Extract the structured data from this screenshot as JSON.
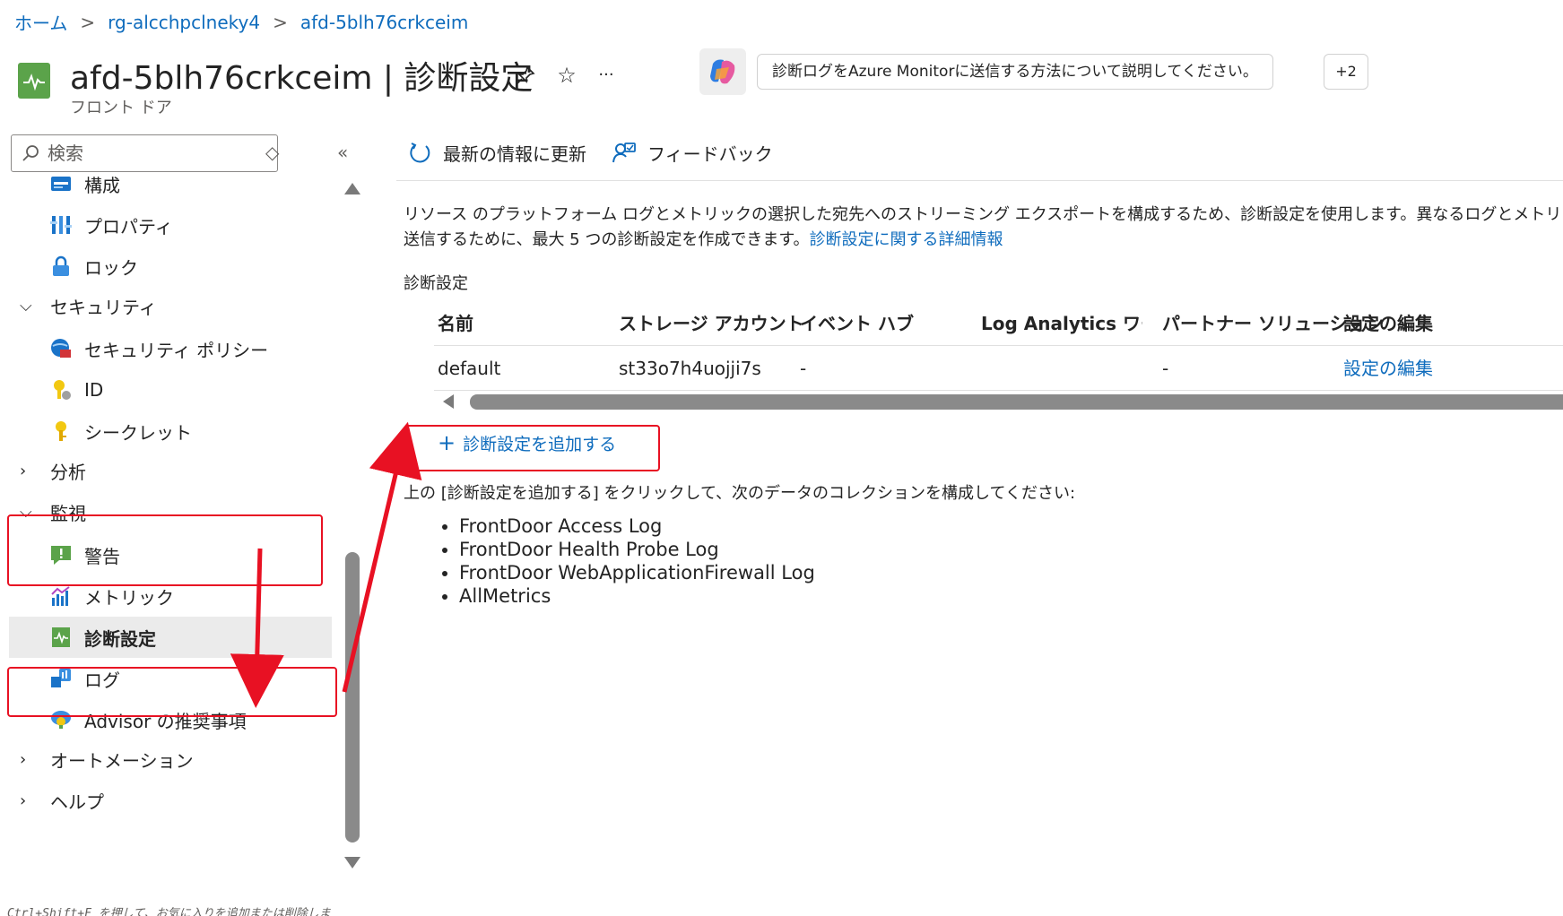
{
  "breadcrumb": {
    "items": [
      "ホーム",
      "rg-alcchpclneky4",
      "afd-5blh76crkceim"
    ],
    "separator": ">"
  },
  "header": {
    "title": "afd-5blh76crkceim | 診断設定",
    "subtitle": "フロント ドア",
    "pin_icon": "pin-icon",
    "star_icon": "star-icon",
    "more_label": "···",
    "copilot_prompt": "診断ログをAzure Monitorに送信する方法について説明してください。",
    "more_prompts": "+2"
  },
  "sidebar": {
    "search_placeholder": "検索",
    "updown_label": "◇",
    "collapse_label": "«",
    "items": [
      {
        "label": "構成",
        "type": "item",
        "icon": "config-icon"
      },
      {
        "label": "プロパティ",
        "type": "item",
        "icon": "properties-icon"
      },
      {
        "label": "ロック",
        "type": "item",
        "icon": "lock-icon"
      },
      {
        "label": "セキュリティ",
        "type": "group",
        "expanded": true
      },
      {
        "label": "セキュリティ ポリシー",
        "type": "item",
        "icon": "security-policy-icon"
      },
      {
        "label": "ID",
        "type": "item",
        "icon": "identity-icon"
      },
      {
        "label": "シークレット",
        "type": "item",
        "icon": "key-icon"
      },
      {
        "label": "分析",
        "type": "group",
        "expanded": false
      },
      {
        "label": "監視",
        "type": "group",
        "expanded": true
      },
      {
        "label": "警告",
        "type": "item",
        "icon": "alert-icon"
      },
      {
        "label": "メトリック",
        "type": "item",
        "icon": "metrics-icon"
      },
      {
        "label": "診断設定",
        "type": "item",
        "icon": "diagnostic-icon",
        "active": true
      },
      {
        "label": "ログ",
        "type": "item",
        "icon": "logs-icon"
      },
      {
        "label": "Advisor の推奨事項",
        "type": "item",
        "icon": "advisor-icon"
      },
      {
        "label": "オートメーション",
        "type": "group",
        "expanded": false
      },
      {
        "label": "ヘルプ",
        "type": "group",
        "expanded": false
      }
    ],
    "hint": "Ctrl+Shift+F を押して、お気に入りを追加または削除しま"
  },
  "toolbar": {
    "refresh_label": "最新の情報に更新",
    "feedback_label": "フィードバック"
  },
  "main": {
    "description_line1": "リソース のプラットフォーム ログとメトリックの選択した宛先へのストリーミング エクスポートを構成するため、診断設定を使用します。異なるログとメトリックを個別の宛",
    "description_line2": "送信するために、最大 5 つの診断設定を作成できます。",
    "learn_more": "診断設定に関する詳細情報",
    "section_label": "診断設定",
    "table": {
      "headers": [
        "名前",
        "ストレージ アカウント",
        "イベント ハブ",
        "Log Analytics ワー…",
        "パートナー ソリューション",
        "設定の編集"
      ],
      "rows": [
        [
          "default",
          "st33o7h4uojji7s",
          "-",
          "",
          "-",
          "設定の編集"
        ]
      ]
    },
    "add_label": "診断設定を追加する",
    "instruction": "上の [診断設定を追加する] をクリックして、次のデータのコレクションを構成してください:",
    "log_types": [
      "FrontDoor Access Log",
      "FrontDoor Health Probe Log",
      "FrontDoor WebApplicationFirewall Log",
      "AllMetrics"
    ]
  },
  "colors": {
    "link": "#0f6cbd",
    "annotation": "#e81123",
    "active_bg": "#ebebeb"
  }
}
